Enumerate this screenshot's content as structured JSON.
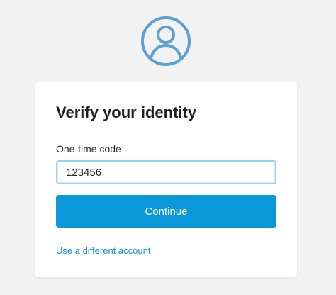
{
  "header": {
    "avatar_icon": "user-circle-icon",
    "avatar_color": "#5aa0d4"
  },
  "card": {
    "title": "Verify your identity",
    "code_label": "One-time code",
    "code_value": "123456",
    "continue_label": "Continue",
    "alt_link_label": "Use a different account"
  },
  "colors": {
    "background": "#f2f2f2",
    "card": "#ffffff",
    "accent": "#0a98d8",
    "link": "#1591cc",
    "input_focus_border": "#8fd3f5"
  }
}
